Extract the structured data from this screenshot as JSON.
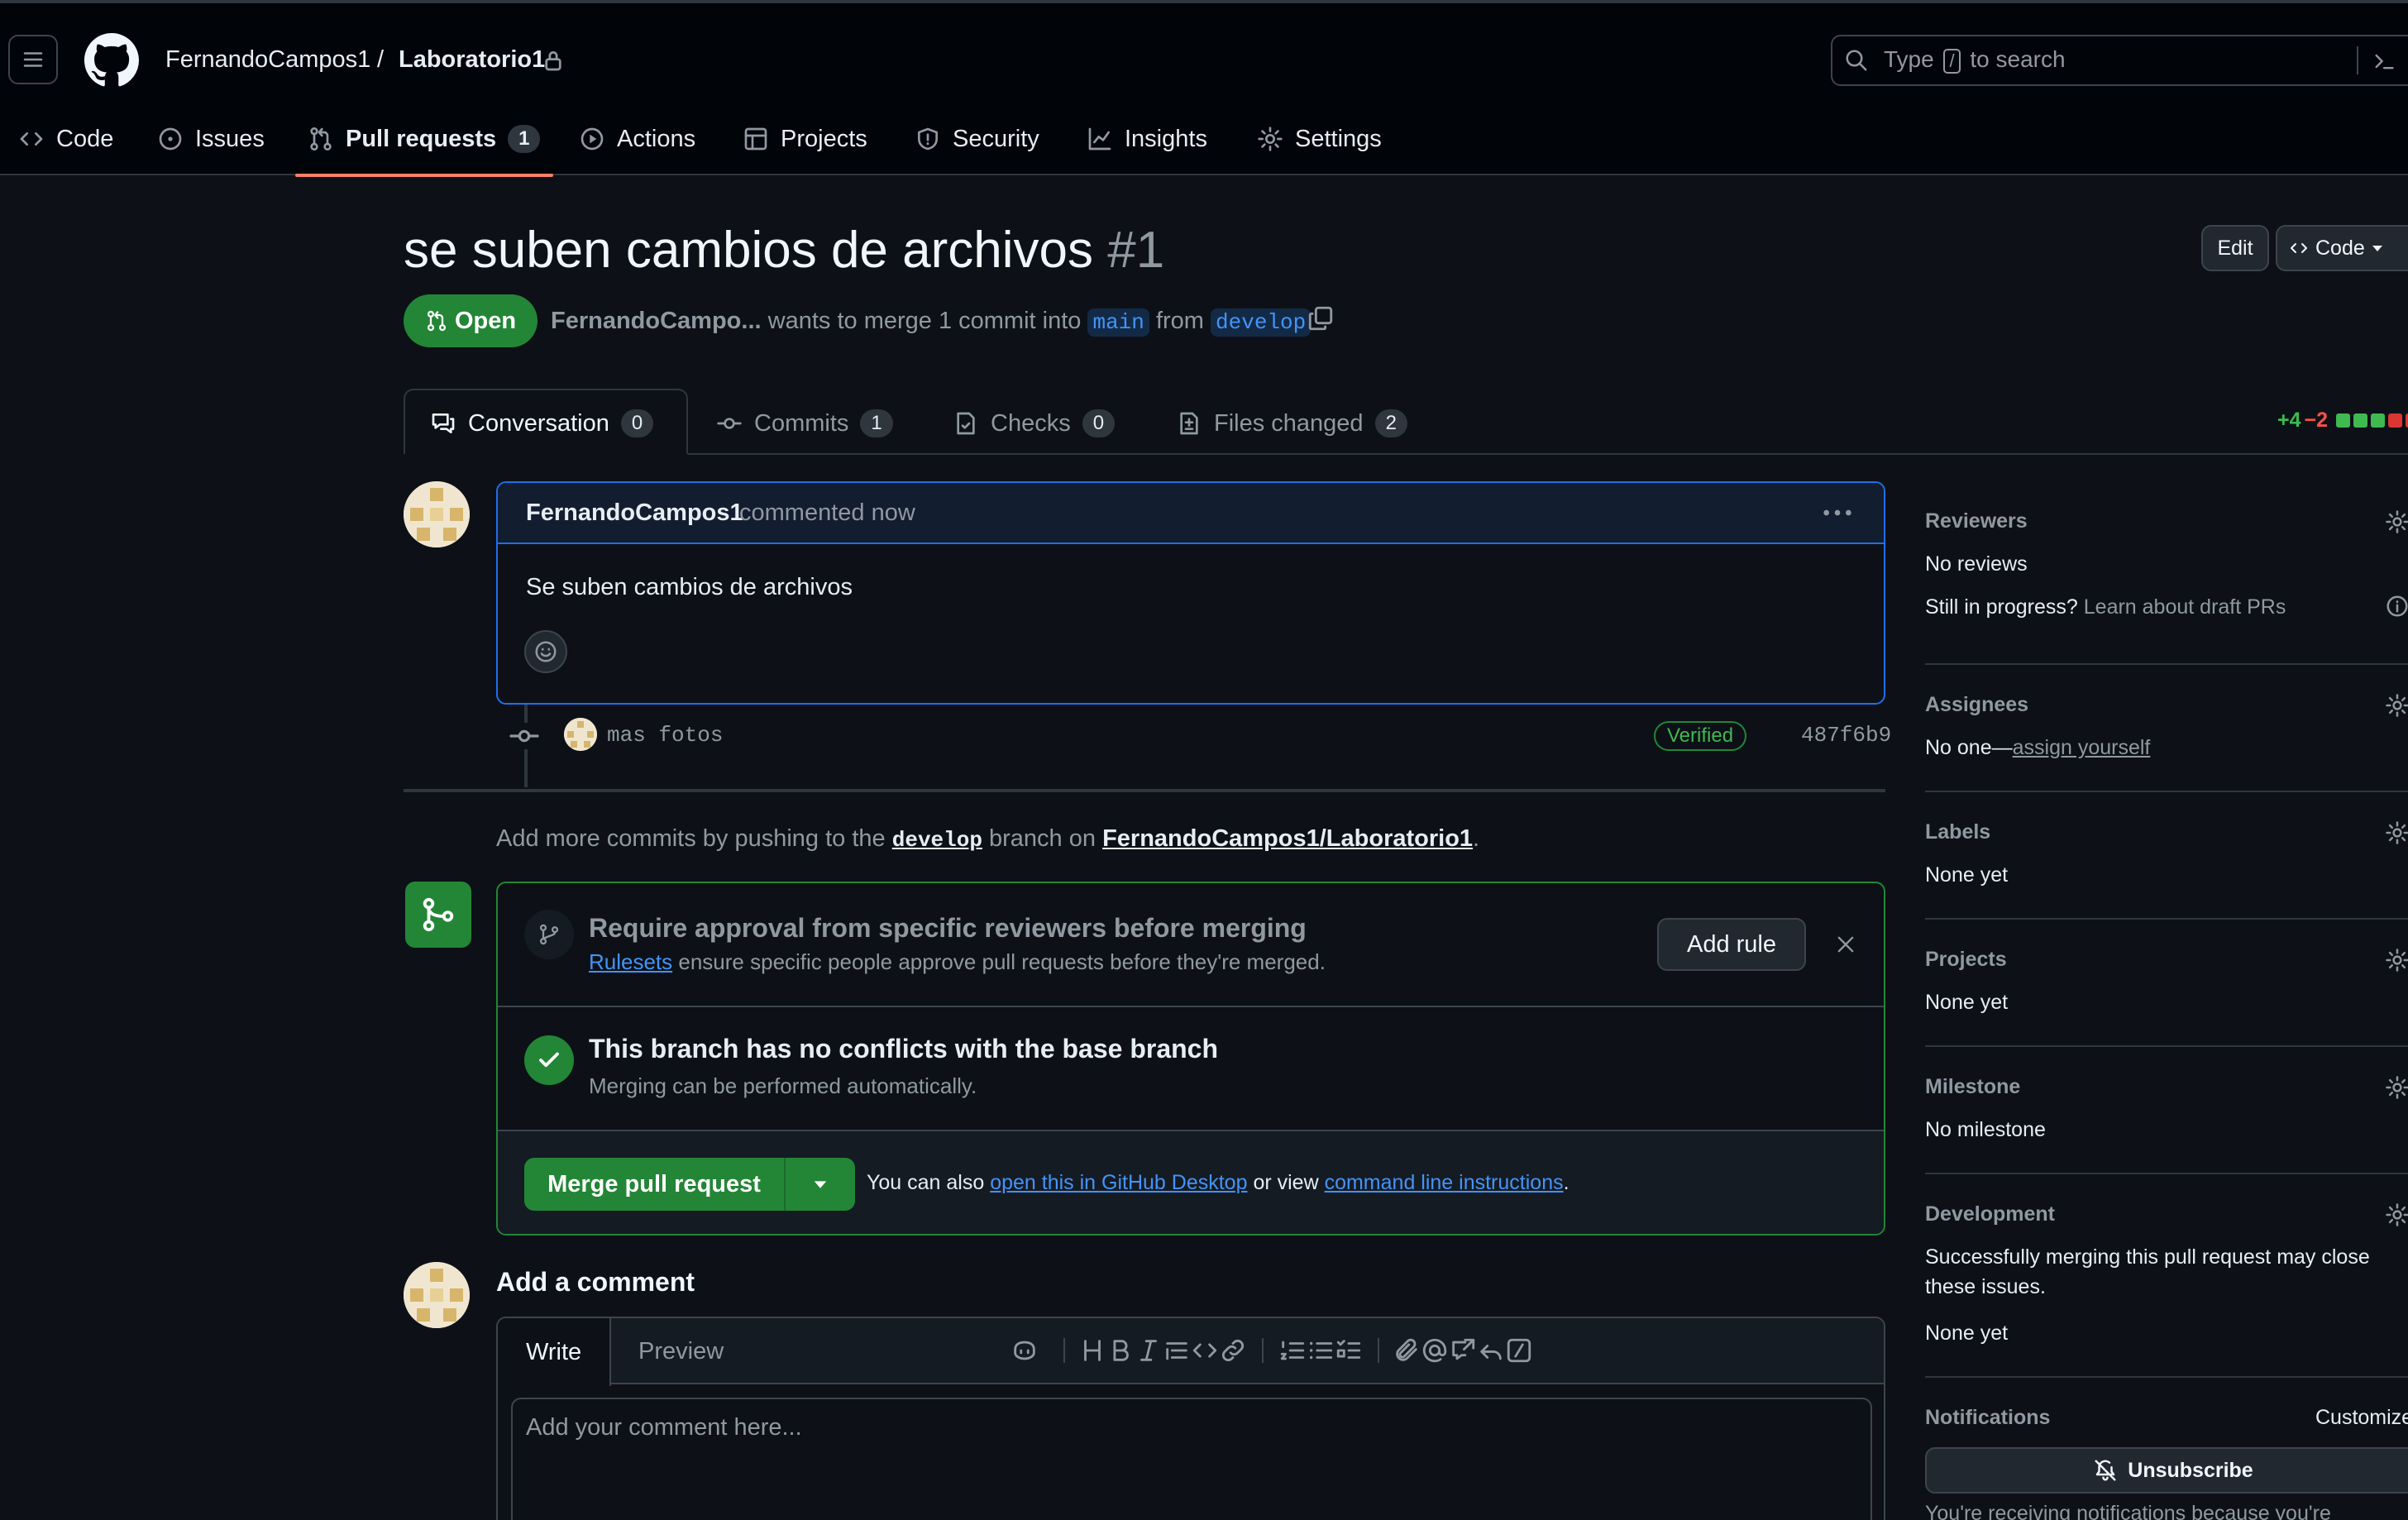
{
  "header": {
    "owner": "FernandoCampos1",
    "separator": "/",
    "repo": "Laboratorio1",
    "search_prefix": "Type",
    "search_key": "/",
    "search_suffix": "to search"
  },
  "nav": {
    "items": [
      {
        "label": "Code",
        "icon": "code-icon"
      },
      {
        "label": "Issues",
        "icon": "issue-icon"
      },
      {
        "label": "Pull requests",
        "icon": "pull-request-icon",
        "count": "1",
        "active": true
      },
      {
        "label": "Actions",
        "icon": "play-icon"
      },
      {
        "label": "Projects",
        "icon": "table-icon"
      },
      {
        "label": "Security",
        "icon": "shield-icon"
      },
      {
        "label": "Insights",
        "icon": "graph-icon"
      },
      {
        "label": "Settings",
        "icon": "gear-icon"
      }
    ]
  },
  "pr": {
    "title": "se suben cambios de archivos",
    "number": "#1",
    "edit_label": "Edit",
    "code_label": "Code",
    "state": "Open",
    "author_short": "FernandoCampo...",
    "merge_text": "wants to merge 1 commit into",
    "base": "main",
    "from_text": "from",
    "head": "develop"
  },
  "tabs": [
    {
      "label": "Conversation",
      "count": "0",
      "icon": "comment-discussion-icon"
    },
    {
      "label": "Commits",
      "count": "1",
      "icon": "commit-icon"
    },
    {
      "label": "Checks",
      "count": "0",
      "icon": "checklist-icon"
    },
    {
      "label": "Files changed",
      "count": "2",
      "icon": "file-diff-icon"
    }
  ],
  "diffstat": {
    "additions": "+4",
    "deletions": "−2",
    "colors": [
      "#3fb950",
      "#3fb950",
      "#3fb950",
      "#da3633",
      "#da3633"
    ]
  },
  "comment": {
    "author": "FernandoCampos1",
    "when": "commented now",
    "body": "Se suben cambios de archivos"
  },
  "commit": {
    "message": "mas fotos",
    "verified": "Verified",
    "sha": "487f6b9"
  },
  "hint": {
    "prefix": "Add more commits by pushing to the",
    "branch": "develop",
    "middle": "branch on",
    "repo_link": "FernandoCampos1/Laboratorio1",
    "suffix": "."
  },
  "merge": {
    "rule_title": "Require approval from specific reviewers before merging",
    "rule_link": "Rulesets",
    "rule_sub": "ensure specific people approve pull requests before they're merged.",
    "add_rule": "Add rule",
    "conflict_title": "This branch has no conflicts with the base branch",
    "conflict_sub": "Merging can be performed automatically.",
    "merge_button": "Merge pull request",
    "also_text": "You can also",
    "desktop_link": "open this in GitHub Desktop",
    "or_text": "or view",
    "cli_link": "command line instructions",
    "period": "."
  },
  "add_comment": {
    "title": "Add a comment",
    "write_tab": "Write",
    "preview_tab": "Preview",
    "placeholder": "Add your comment here..."
  },
  "sidebar": {
    "reviewers_title": "Reviewers",
    "reviewers_value": "No reviews",
    "draft_q": "Still in progress?",
    "draft_link": "Learn about draft PRs",
    "assignees_title": "Assignees",
    "assignees_value": "No one—",
    "assign_link": "assign yourself",
    "labels_title": "Labels",
    "labels_value": "None yet",
    "projects_title": "Projects",
    "projects_value": "None yet",
    "milestone_title": "Milestone",
    "milestone_value": "No milestone",
    "development_title": "Development",
    "development_line1": "Successfully merging this pull request may close",
    "development_line2": "these issues.",
    "development_value": "None yet",
    "notifications_title": "Notifications",
    "customize": "Customize",
    "unsubscribe": "Unsubscribe",
    "notif_note": "You're receiving notifications because you're"
  }
}
